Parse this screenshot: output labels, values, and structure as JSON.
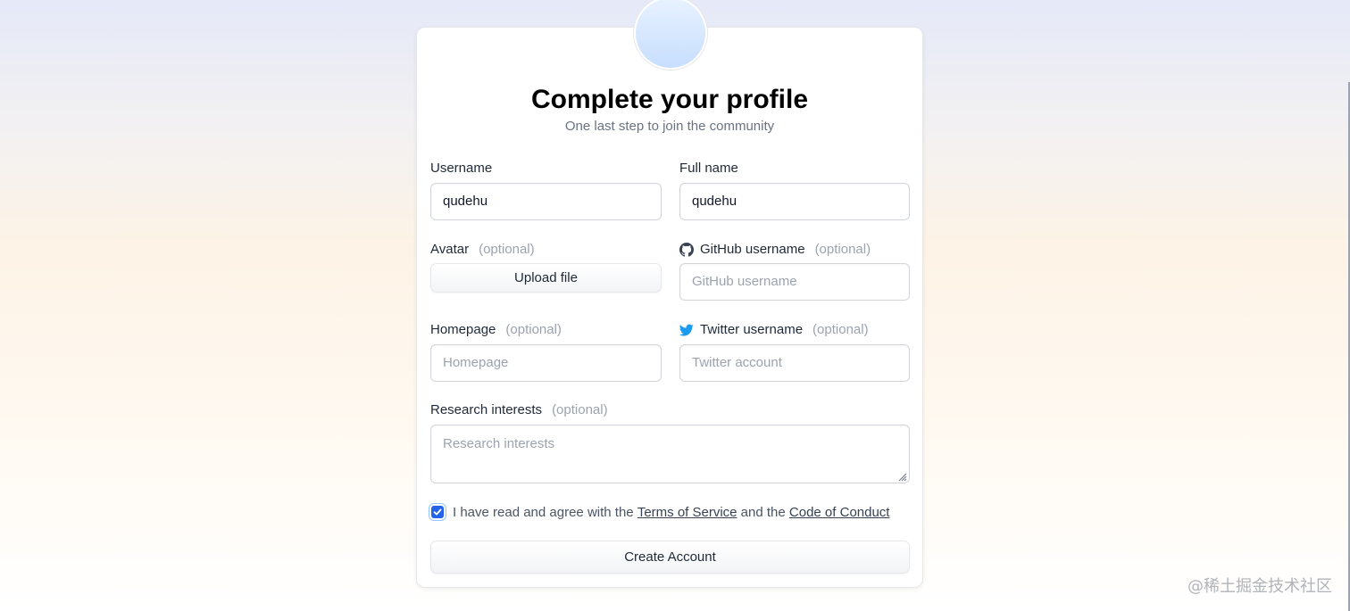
{
  "header": {
    "title": "Complete your profile",
    "subtitle": "One last step to join the community"
  },
  "form": {
    "username": {
      "label": "Username",
      "value": "qudehu"
    },
    "full_name": {
      "label": "Full name",
      "value": "qudehu"
    },
    "avatar": {
      "label": "Avatar",
      "optional": "(optional)",
      "button": "Upload file"
    },
    "github": {
      "label": "GitHub username",
      "optional": "(optional)",
      "placeholder": "GitHub username",
      "icon": "github-icon"
    },
    "homepage": {
      "label": "Homepage",
      "optional": "(optional)",
      "placeholder": "Homepage"
    },
    "twitter": {
      "label": "Twitter username",
      "optional": "(optional)",
      "placeholder": "Twitter account",
      "icon": "twitter-icon"
    },
    "research": {
      "label": "Research interests",
      "optional": "(optional)",
      "placeholder": "Research interests"
    },
    "agreement": {
      "checked": true,
      "text_before": "I have read and agree with the ",
      "terms_link": "Terms of Service",
      "text_middle": " and the ",
      "conduct_link": "Code of Conduct"
    },
    "submit_label": "Create Account"
  },
  "watermark": "@稀土掘金技术社区",
  "colors": {
    "accent": "#2563eb",
    "twitter": "#1d9bf0",
    "optional_text": "#9ca3af"
  }
}
